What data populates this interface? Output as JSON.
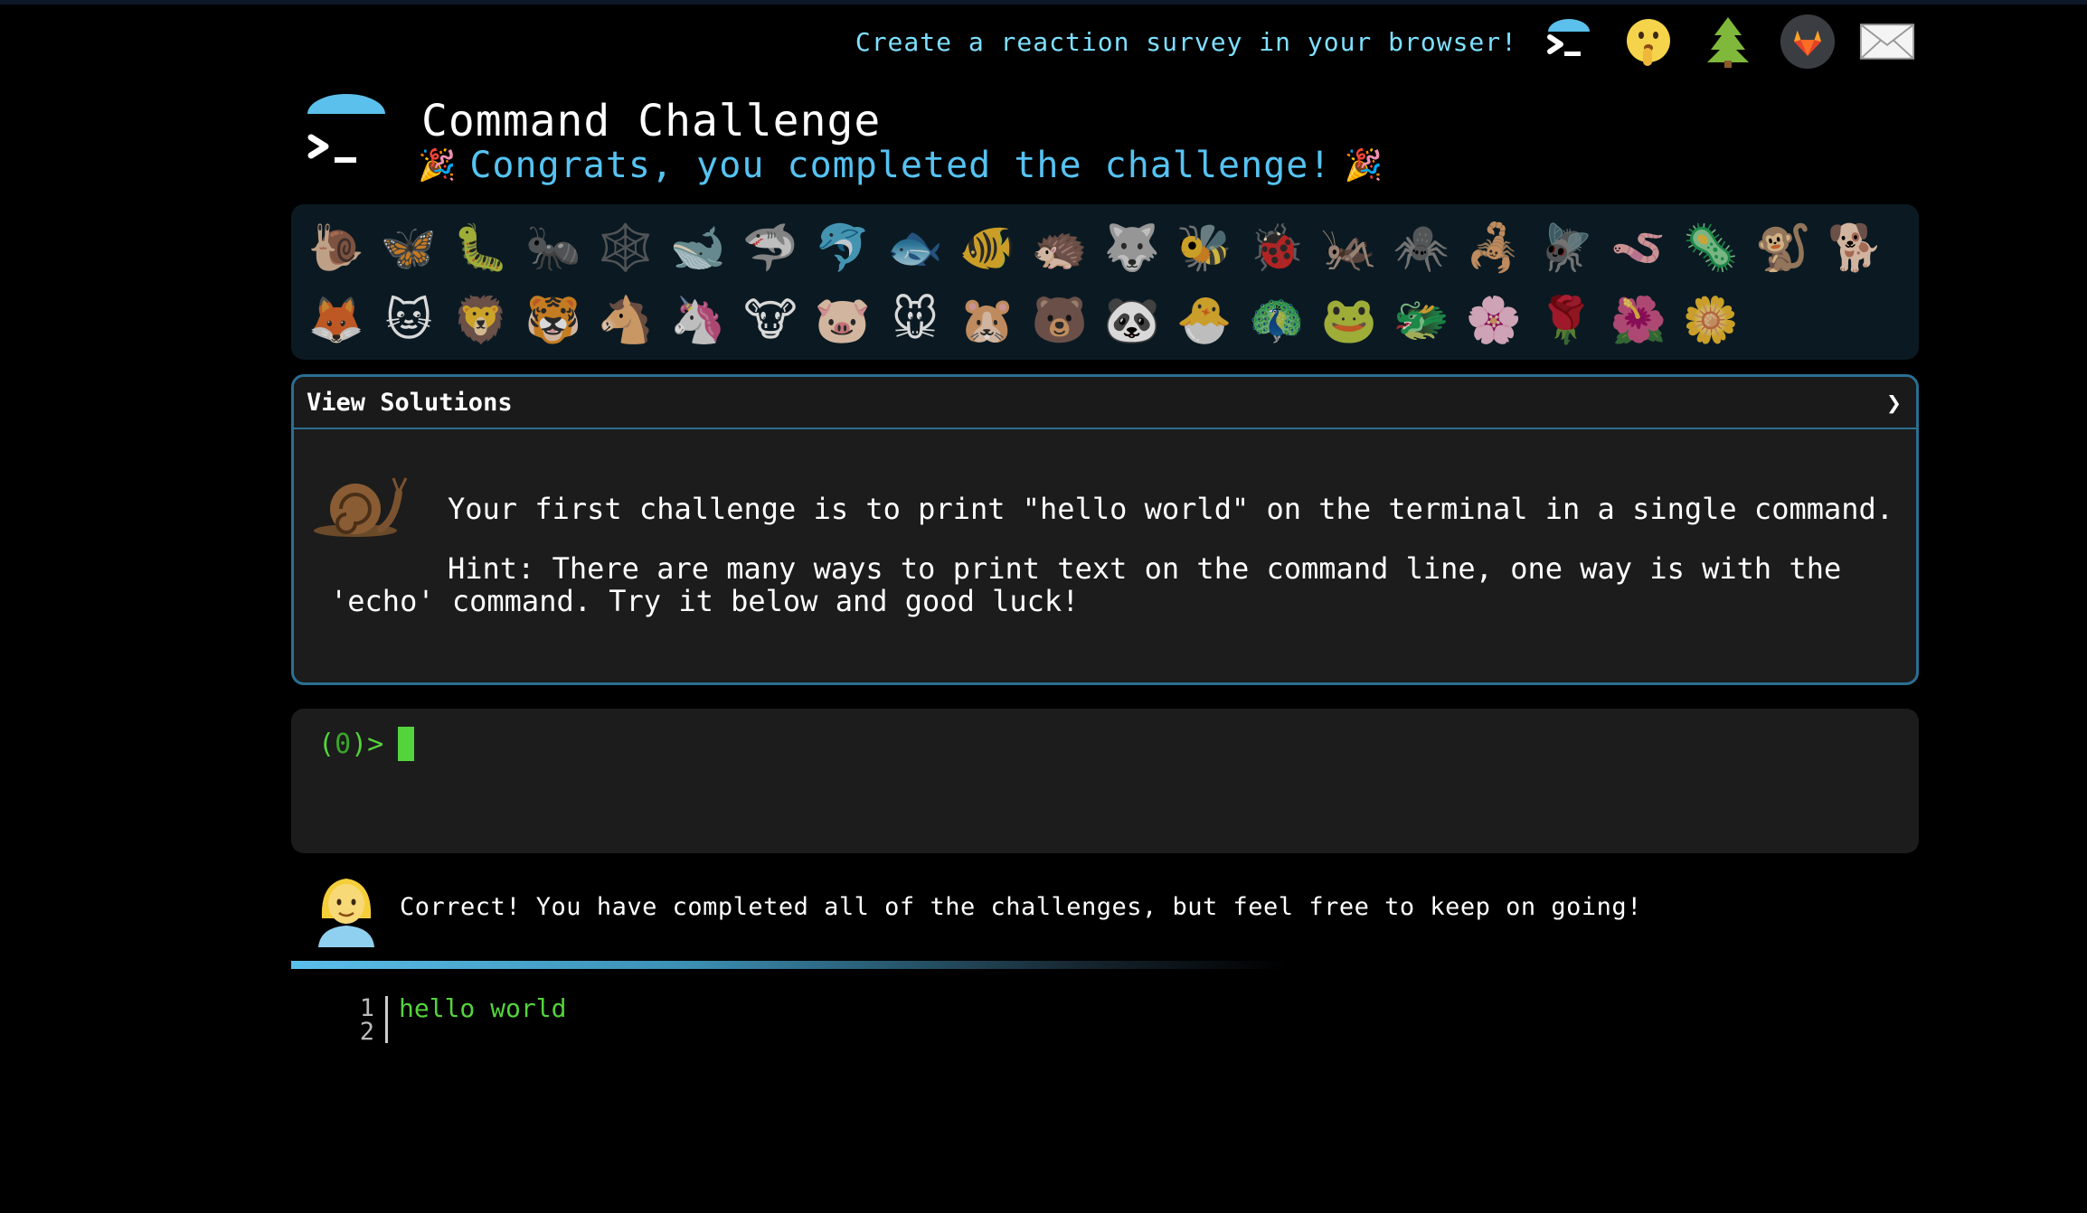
{
  "topbar": {
    "promo": "Create a reaction survey in your browser!",
    "icons": [
      "terminal-logo-icon",
      "shushing-face-icon",
      "tree-icon",
      "gitlab-icon",
      "envelope-icon"
    ]
  },
  "header": {
    "title": "Command Challenge",
    "subtitle": "Congrats, you completed the challenge!",
    "party": "🎉"
  },
  "animals": [
    "🐌",
    "🦋",
    "🐛",
    "🐜",
    "🕸️",
    "🐋",
    "🦈",
    "🐬",
    "🐟",
    "🐠",
    "🦔",
    "🐺",
    "🐝",
    "🐞",
    "🦗",
    "🕷️",
    "🦂",
    "🪰",
    "🪱",
    "🦠",
    "🐒",
    "🐕",
    "🦊",
    "🐱",
    "🦁",
    "🐯",
    "🐴",
    "🦄",
    "🐮",
    "🐷",
    "🐭",
    "🐹",
    "🐻",
    "🐼",
    "🐣",
    "🦚",
    "🐸",
    "🐲",
    "🌸",
    "🌹",
    "🌺",
    "🌼"
  ],
  "challenge": {
    "header": "View Solutions",
    "chevron": "❯",
    "text": "Your first challenge is to print \"hello world\" on the terminal in a single command.",
    "hint_line1": "Hint: There are many ways to print text on the command line, one way is with the",
    "hint_line2": "'echo' command. Try it below and good luck!"
  },
  "terminal": {
    "prompt_open": "(",
    "prompt_num": "0",
    "prompt_close": ")>"
  },
  "result": {
    "message": "Correct! You have completed all of the challenges, but feel free to keep on going!"
  },
  "output": {
    "lines": [
      {
        "num": "1",
        "text": "hello world"
      },
      {
        "num": "2",
        "text": ""
      }
    ]
  },
  "colors": {
    "accent": "#56c3f2",
    "promo": "#7ee0ff",
    "border": "#2b6f92",
    "terminal_green": "#54d43c",
    "panel": "#1c1c1c",
    "strip": "#0b1a22"
  }
}
